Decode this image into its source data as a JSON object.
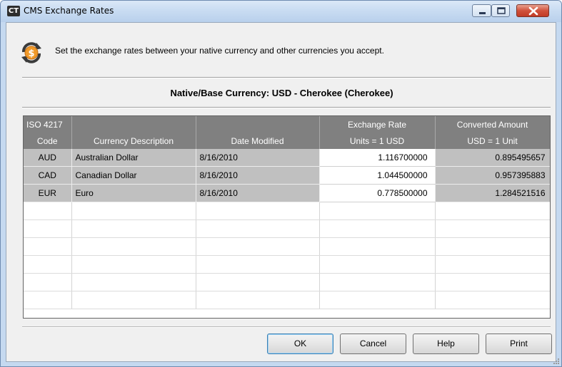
{
  "window": {
    "title": "CMS Exchange Rates",
    "app_icon_text": "CT"
  },
  "header": {
    "icon": "currency-exchange-icon",
    "instructions": "Set the exchange rates between your native currency and other currencies you accept."
  },
  "native_currency": "Native/Base Currency:  USD - Cherokee (Cherokee)",
  "grid": {
    "columns": [
      {
        "line1": "ISO 4217",
        "line2": "Code"
      },
      {
        "line1": "",
        "line2": "Currency Description"
      },
      {
        "line1": "",
        "line2": "Date Modified"
      },
      {
        "line1": "Exchange Rate",
        "line2": "Units = 1 USD"
      },
      {
        "line1": "Converted Amount",
        "line2": "USD = 1 Unit"
      }
    ],
    "rows": [
      {
        "code": "AUD",
        "description": "Australian Dollar",
        "date": "8/16/2010",
        "rate": "1.116700000",
        "converted": "0.895495657"
      },
      {
        "code": "CAD",
        "description": "Canadian Dollar",
        "date": "8/16/2010",
        "rate": "1.044500000",
        "converted": "0.957395883"
      },
      {
        "code": "EUR",
        "description": "Euro",
        "date": "8/16/2010",
        "rate": "0.778500000",
        "converted": "1.284521516"
      }
    ],
    "empty_rows": 6
  },
  "buttons": {
    "ok": "OK",
    "cancel": "Cancel",
    "help": "Help",
    "print": "Print"
  },
  "colors": {
    "grid_header": "#808080",
    "row_fill": "#c0c0c0",
    "close_button": "#c94a35"
  }
}
